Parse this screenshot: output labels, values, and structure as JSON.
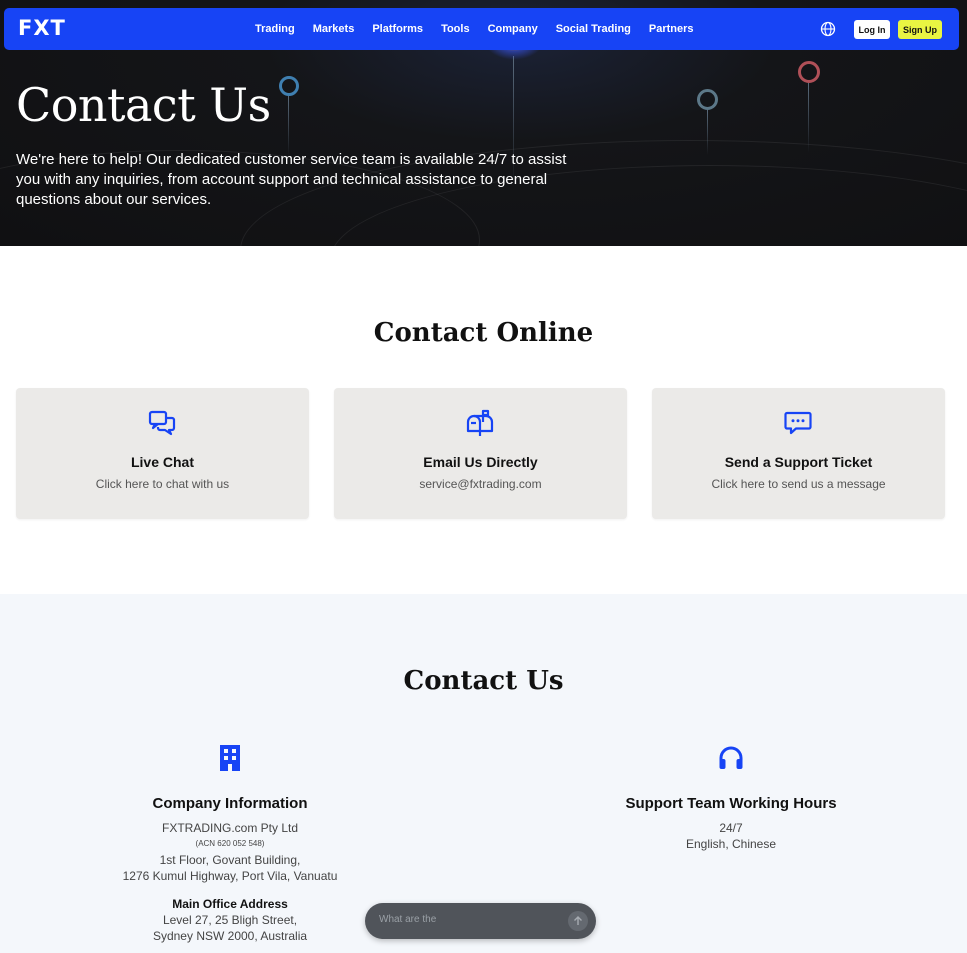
{
  "brand": {
    "logo": "FXT",
    "accent": "#1744f5",
    "signup_color": "#e9f542"
  },
  "nav": {
    "links": [
      "Trading",
      "Markets",
      "Platforms",
      "Tools",
      "Company",
      "Social Trading",
      "Partners"
    ],
    "language_icon": "globe-icon",
    "login_label": "Log In",
    "signup_label": "Sign Up"
  },
  "hero": {
    "title": "Contact Us",
    "description": "We're here to help! Our dedicated customer service team is available 24/7 to assist you with any inquiries, from account support and technical assistance to general questions about our services."
  },
  "contact_online": {
    "title": "Contact Online",
    "cards": [
      {
        "icon": "chat-bubbles-icon",
        "title": "Live Chat",
        "subtitle": "Click here to chat with us"
      },
      {
        "icon": "mailbox-icon",
        "title": "Email Us Directly",
        "subtitle": "service@fxtrading.com"
      },
      {
        "icon": "message-ticket-icon",
        "title": "Send a Support Ticket",
        "subtitle": "Click here to send us a message"
      }
    ]
  },
  "contact_us": {
    "title": "Contact Us",
    "company": {
      "icon": "building-icon",
      "title": "Company Information",
      "name": "FXTRADING.com Pty Ltd",
      "acn": "(ACN 620 052 548)",
      "address_line1": "1st Floor, Govant Building,",
      "address_line2": "1276 Kumul Highway, Port Vila, Vanuatu",
      "main_office_title": "Main Office Address",
      "main_office_line1": "Level 27, 25 Bligh Street,",
      "main_office_line2": "Sydney NSW 2000, Australia"
    },
    "hours": {
      "icon": "headphones-icon",
      "title": "Support Team Working Hours",
      "availability": "24/7",
      "languages": "English, Chinese"
    }
  },
  "chat_widget": {
    "placeholder": "What are the",
    "send_icon": "arrow-up-icon"
  }
}
